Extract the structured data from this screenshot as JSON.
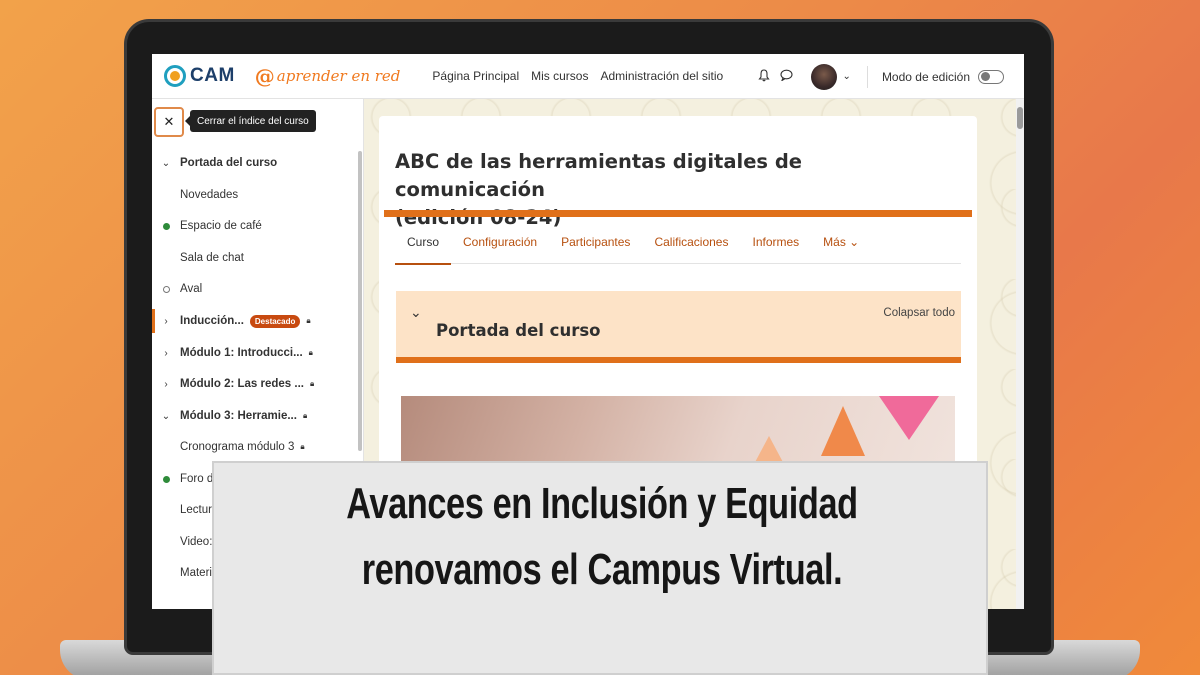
{
  "navbar": {
    "logo_cam": "CAM",
    "logo_aprender_at": "@",
    "logo_aprender": "aprender en red",
    "links": [
      "Página Principal",
      "Mis cursos",
      "Administración del sitio"
    ],
    "edit_mode_label": "Modo de edición",
    "edit_mode_on": false,
    "icons": [
      "bell-icon",
      "chat-icon",
      "chevron-down-icon"
    ]
  },
  "sidebar": {
    "close_symbol": "✕",
    "tooltip": "Cerrar el índice del curso",
    "items": [
      {
        "label": "Portada del curso",
        "marker": "expanded",
        "bold": true
      },
      {
        "label": "Novedades",
        "marker": "none",
        "bold": false
      },
      {
        "label": "Espacio de café",
        "marker": "complete",
        "bold": false
      },
      {
        "label": "Sala de chat",
        "marker": "none",
        "bold": false
      },
      {
        "label": "Aval",
        "marker": "incomplete",
        "bold": false
      },
      {
        "label": "Inducción...",
        "marker": "collapsed",
        "bold": true,
        "badge": "Destacado",
        "locked": true,
        "active": true
      },
      {
        "label": "Módulo 1: Introducci...",
        "marker": "collapsed",
        "bold": true,
        "locked": true
      },
      {
        "label": "Módulo 2: Las redes ...",
        "marker": "collapsed",
        "bold": true,
        "locked": true
      },
      {
        "label": "Módulo 3: Herramie...",
        "marker": "expanded",
        "bold": true,
        "locked": true
      },
      {
        "label": "Cronograma módulo 3",
        "marker": "none",
        "bold": false,
        "locked": true
      },
      {
        "label": "Foro d",
        "marker": "complete",
        "bold": false
      },
      {
        "label": "Lectur",
        "marker": "none",
        "bold": false
      },
      {
        "label": "Video:",
        "marker": "none",
        "bold": false
      },
      {
        "label": "Materi",
        "marker": "none",
        "bold": false
      }
    ]
  },
  "course": {
    "title_line1": "ABC de las herramientas digitales de comunicación",
    "title_line2": "(edición 08-24)",
    "tabs": [
      "Curso",
      "Configuración",
      "Participantes",
      "Calificaciones",
      "Informes",
      "Más ⌄"
    ],
    "active_tab": "Curso",
    "section_title": "Portada del curso",
    "collapse_all": "Colapsar todo"
  },
  "banner": {
    "line1": "Avances en Inclusión y Equidad",
    "line2": "renovamos el Campus Virtual."
  },
  "colors": {
    "accent": "#e0701a",
    "link": "#b7500f",
    "section_bg": "#fde3c7",
    "badge": "#c84a10",
    "complete_dot": "#2e8b3a"
  }
}
